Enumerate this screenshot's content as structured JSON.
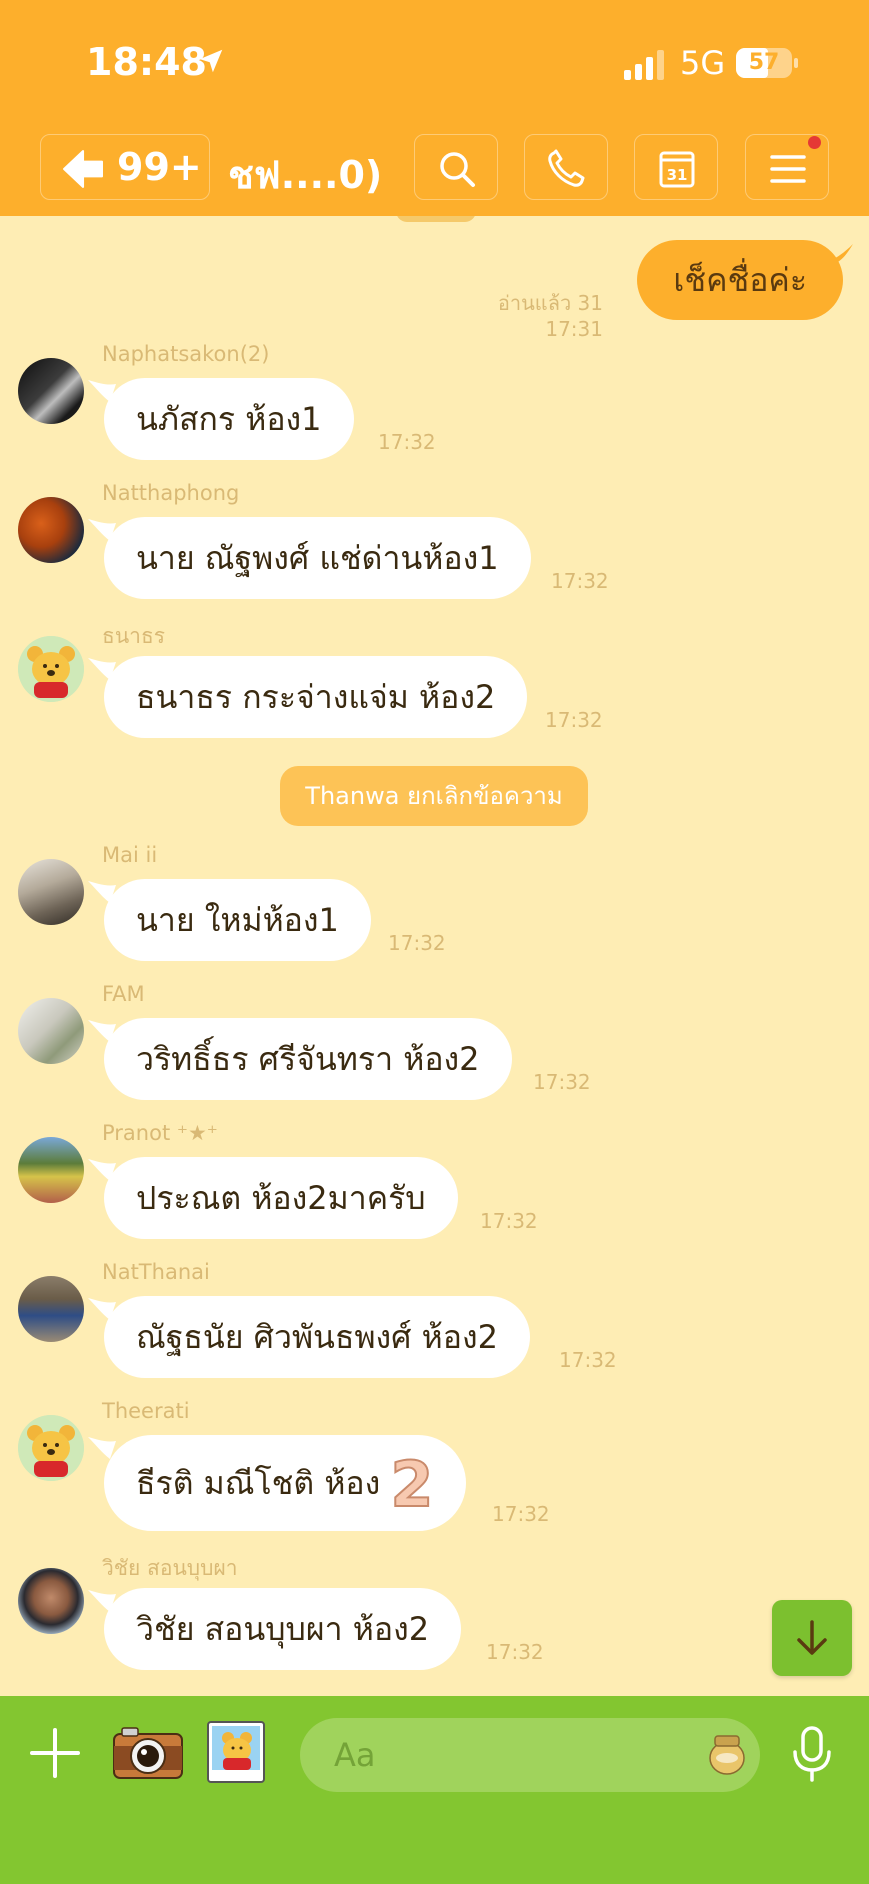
{
  "status_bar": {
    "time": "18:48",
    "network": "5G",
    "battery": "57",
    "battery_level": 0.57
  },
  "header": {
    "back_count": "99+",
    "title": "ชฟ....0)"
  },
  "chat": {
    "outgoing": {
      "text": "เช็คชื่อค่ะ",
      "read": "อ่านแล้ว 31",
      "time": "17:31"
    },
    "messages": [
      {
        "sender": "Naphatsakon(2)",
        "text": "นภัสกร ห้อง1",
        "time": "17:32"
      },
      {
        "sender": "Natthaphong",
        "text": "นาย ณัฐพงศ์ แช่ด่านห้อง1",
        "time": "17:32"
      },
      {
        "sender": "ธนาธร",
        "text": "ธนาธร กระจ่างแจ่ม ห้อง2",
        "time": "17:32"
      },
      {
        "sender": "Mai ii",
        "text": "นาย ใหม่ห้อง1",
        "time": "17:32"
      },
      {
        "sender": "FAM",
        "text": "วริทธิ์ธร ศรีจันทรา ห้อง2",
        "time": "17:32"
      },
      {
        "sender": "Pranot ⁺★⁺",
        "text": "ประณต ห้อง2มาครับ",
        "time": "17:32"
      },
      {
        "sender": "NatThanai",
        "text": "ณัฐธนัย ศิวพันธพงศ์ ห้อง2",
        "time": "17:32"
      },
      {
        "sender": "Theerati",
        "text": "ธีรติ มณีโชติ ห้อง",
        "emoji": "2",
        "time": "17:32"
      },
      {
        "sender": "วิชัย   สอนบุบผา",
        "text": "วิชัย สอนบุบผา ห้อง2",
        "time": "17:32"
      }
    ],
    "system": "Thanwa ยกเลิกข้อความ"
  },
  "input": {
    "placeholder": "Aa"
  },
  "colors": {
    "header": "#FDAF2C",
    "background": "#FEEDB4",
    "bottom_bar": "#83C630",
    "outgoing_bubble": "#FDAF2C"
  },
  "icons": [
    "back-arrow-icon",
    "search-icon",
    "phone-icon",
    "calendar-icon",
    "menu-icon",
    "plus-icon",
    "camera-icon",
    "sticker-icon",
    "emoji-icon",
    "mic-icon",
    "arrow-down-icon"
  ]
}
